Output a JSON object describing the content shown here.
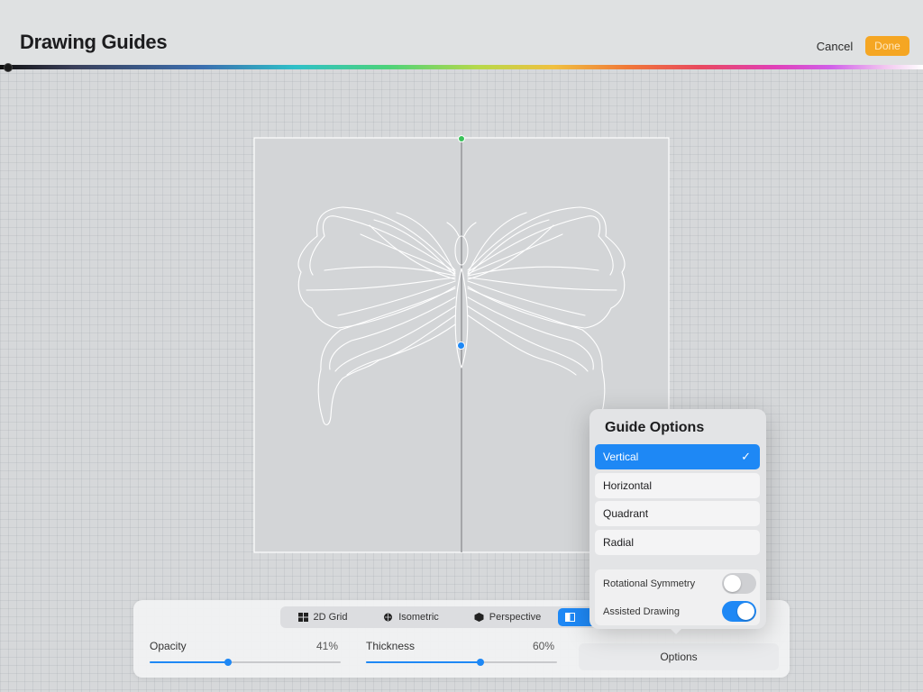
{
  "header": {
    "title": "Drawing Guides",
    "cancel_label": "Cancel",
    "done_label": "Done"
  },
  "guide_types": [
    {
      "label": "2D Grid",
      "icon": "grid-icon"
    },
    {
      "label": "Isometric",
      "icon": "isometric-icon"
    },
    {
      "label": "Perspective",
      "icon": "perspective-icon"
    },
    {
      "label": "",
      "icon": "symmetry-icon",
      "active": true
    }
  ],
  "sliders": {
    "opacity": {
      "label": "Opacity",
      "value_text": "41%",
      "value": 0.41
    },
    "thickness": {
      "label": "Thickness",
      "value_text": "60%",
      "value": 0.6
    }
  },
  "options_label": "Options",
  "guide_options": {
    "title": "Guide Options",
    "items": [
      {
        "label": "Vertical",
        "selected": true
      },
      {
        "label": "Horizontal",
        "selected": false
      },
      {
        "label": "Quadrant",
        "selected": false
      },
      {
        "label": "Radial",
        "selected": false
      }
    ],
    "toggles": [
      {
        "label": "Rotational Symmetry",
        "on": false
      },
      {
        "label": "Assisted Drawing",
        "on": true
      }
    ]
  },
  "colors": {
    "accent": "#1e88f5",
    "done": "#f5a623",
    "handle_top": "#3ac25a"
  }
}
